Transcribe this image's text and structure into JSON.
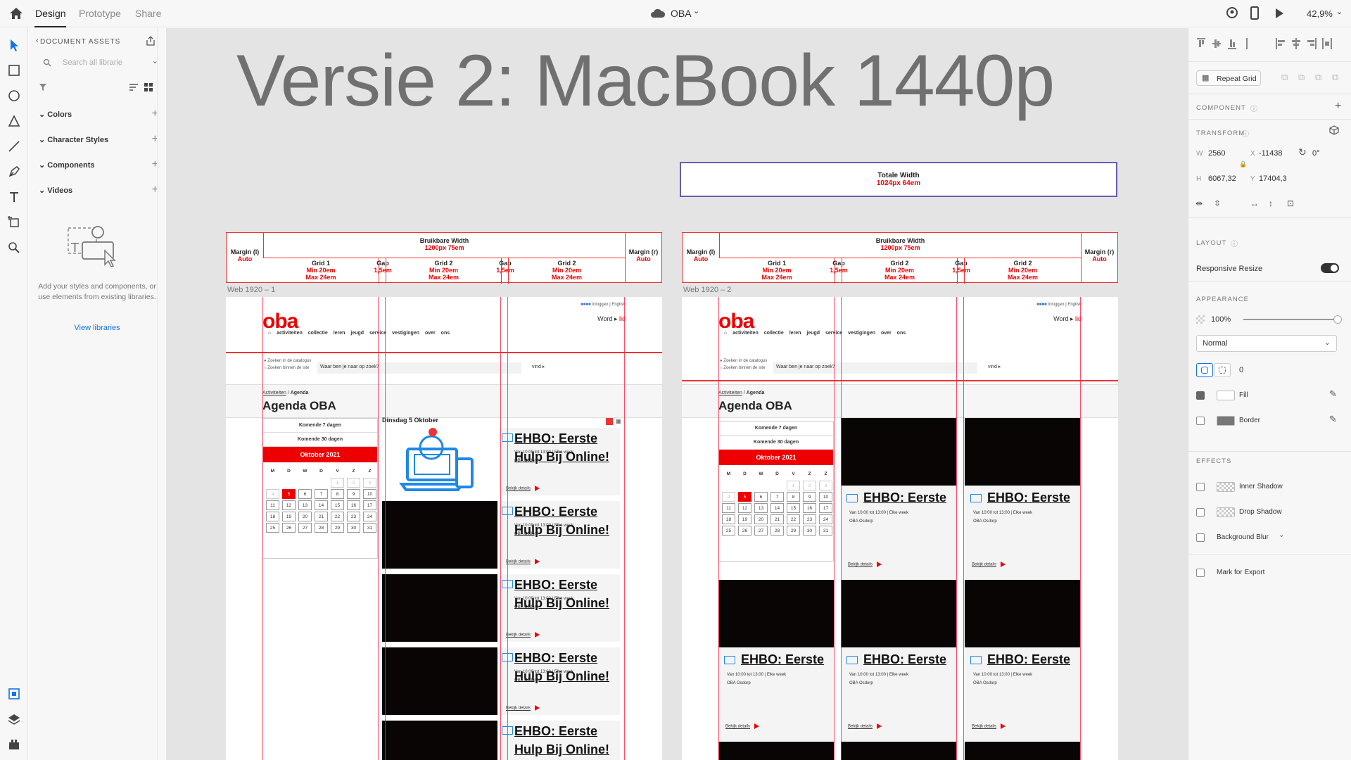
{
  "topbar": {
    "tabs": [
      "Design",
      "Prototype",
      "Share"
    ],
    "doc_title": "OBA",
    "zoom": "42,9%"
  },
  "assets": {
    "header": "DOCUMENT ASSETS",
    "search_placeholder": "Search all librarie",
    "sections": [
      "Colors",
      "Character Styles",
      "Components",
      "Videos"
    ],
    "empty_text": "Add your styles and components, or use elements from existing libraries.",
    "view_libraries": "View libraries"
  },
  "canvas": {
    "title": "Versie 2: MacBook 1440p",
    "total_width": {
      "label": "Totale Width",
      "value": "1024px 64em"
    },
    "grid_header": {
      "margin_l": "Margin (l)",
      "margin_r": "Margin (r)",
      "auto": "Auto",
      "usable": "Bruikbare Width",
      "usable_value": "1200px 75em",
      "grid1": "Grid 1",
      "grid2": "Grid 2",
      "gap": "Gap",
      "gap_value": "1,5em",
      "grid_min": "Min 20em",
      "grid_max": "Max 24em"
    },
    "artboards": [
      {
        "label": "Web 1920 – 1"
      },
      {
        "label": "Web 1920 – 2"
      }
    ],
    "page": {
      "logo": "oba",
      "top_links": "Inloggen | English",
      "word": "Word",
      "lid": "lid",
      "nav": [
        "activiteiten",
        "collectie",
        "leren",
        "jeugd",
        "service",
        "vestigingen",
        "over ons"
      ],
      "radio1": "Zoeken in de catalogus",
      "radio2": "Zoeken binnen de site",
      "search_text": "Waar ben je naar op zoek?",
      "search_btn": "vind ▸",
      "crumb_link": "Activiteiten",
      "crumb_current": "Agenda",
      "heading": "Agenda OBA",
      "btn7": "Komende 7 dagen",
      "btn30": "Komende 30 dagen",
      "month": "Oktober 2021",
      "dow": [
        "M",
        "D",
        "W",
        "D",
        "V",
        "Z",
        "Z"
      ],
      "day_label": "Dinsdag 5 Oktober",
      "card_title": "EHBO: Eerste Hulp Bij Online!",
      "card_title_short": "EHBO: Eerste",
      "card_time": "Van 10:00 tot 13:00 | Elke week",
      "card_loc": "OBA Osdorp",
      "card_link": "Bekijk details"
    }
  },
  "props": {
    "repeat_grid": "Repeat Grid",
    "component": "COMPONENT",
    "transform": "TRANSFORM",
    "w_label": "W",
    "w": "2560",
    "x_label": "X",
    "x": "-11438",
    "rot": "0°",
    "h_label": "H",
    "h": "6067,32",
    "y_label": "Y",
    "y": "17404,3",
    "layout": "LAYOUT",
    "responsive_resize": "Responsive Resize",
    "appearance": "APPEARANCE",
    "opacity": "100%",
    "blend": "Normal",
    "radius": "0",
    "fill": "Fill",
    "border": "Border",
    "effects": "EFFECTS",
    "inner_shadow": "Inner Shadow",
    "drop_shadow": "Drop Shadow",
    "background_blur": "Background Blur",
    "mark_export": "Mark for Export"
  }
}
